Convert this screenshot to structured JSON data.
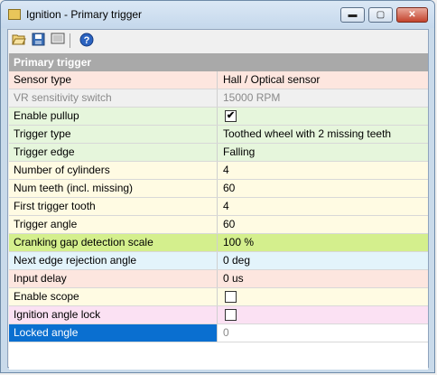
{
  "window": {
    "title": "Ignition - Primary trigger",
    "controls": {
      "minimize": "▬",
      "maximize": "▢",
      "close": "✕"
    }
  },
  "toolbar": {
    "icons": [
      "open-folder-icon",
      "save-icon",
      "screen-icon",
      "help-icon"
    ]
  },
  "section": {
    "title": "Primary trigger"
  },
  "rows": [
    {
      "label": "Sensor type",
      "value": "Hall / Optical sensor",
      "bg": "#fde6df"
    },
    {
      "label": "VR sensitivity switch",
      "value": "15000 RPM",
      "bg": "#f0f0f0",
      "disabled": true
    },
    {
      "label": "Enable pullup",
      "value": "",
      "checkbox": true,
      "checked": true,
      "bg": "#e6f6dc"
    },
    {
      "label": "Trigger type",
      "value": "Toothed wheel with 2 missing teeth",
      "bg": "#e6f6dc"
    },
    {
      "label": "Trigger edge",
      "value": "Falling",
      "bg": "#e6f6dc"
    },
    {
      "label": "Number of cylinders",
      "value": "4",
      "bg": "#fffbe3"
    },
    {
      "label": "Num teeth (incl. missing)",
      "value": "60",
      "bg": "#fffbe3"
    },
    {
      "label": "First trigger tooth",
      "value": "4",
      "bg": "#fffbe3"
    },
    {
      "label": "Trigger angle",
      "value": "60",
      "bg": "#fffbe3"
    },
    {
      "label": "Cranking gap detection scale",
      "value": "100 %",
      "bg": "#d4ef8d"
    },
    {
      "label": "Next edge rejection angle",
      "value": "0 deg",
      "bg": "#e3f4fb"
    },
    {
      "label": "Input delay",
      "value": "0 us",
      "bg": "#fde6df"
    },
    {
      "label": "Enable scope",
      "value": "",
      "checkbox": true,
      "checked": false,
      "bg": "#fffbe3"
    },
    {
      "label": "Ignition angle lock",
      "value": "",
      "checkbox": true,
      "checked": false,
      "bg": "#fbe1f3"
    },
    {
      "label": "Locked angle",
      "value": "0",
      "bg": "#ffffff",
      "selected": true,
      "disabled": true
    }
  ]
}
